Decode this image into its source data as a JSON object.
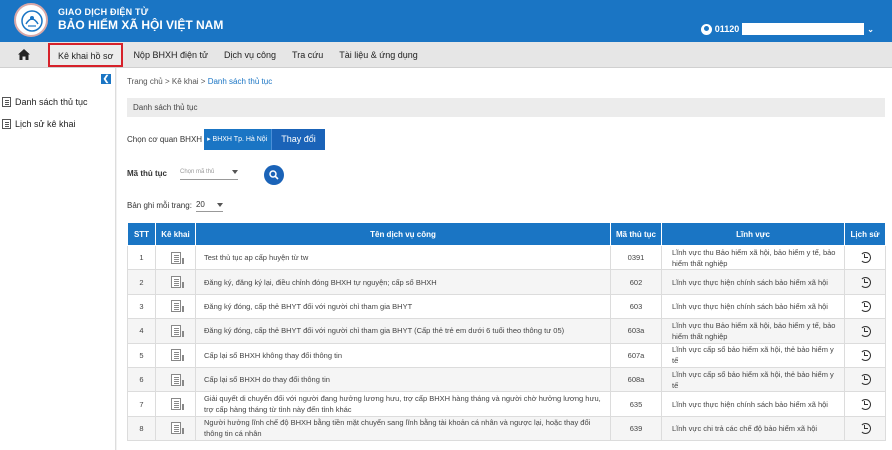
{
  "header": {
    "line1": "GIAO DỊCH ĐIỆN TỬ",
    "line2": "BẢO HIỂM XÃ HỘI VIỆT NAM",
    "user_prefix": "01120",
    "caret": "❯"
  },
  "menu": {
    "items": [
      {
        "label": "Kê khai hồ sơ"
      },
      {
        "label": "Nộp BHXH điện tử"
      },
      {
        "label": "Dịch vụ công"
      },
      {
        "label": "Tra cứu"
      },
      {
        "label": "Tài liệu & ứng dụng"
      }
    ]
  },
  "sidebar": {
    "items": [
      {
        "label": "Danh sách thủ tục"
      },
      {
        "label": "Lịch sử kê khai"
      }
    ]
  },
  "breadcrumb": {
    "home": "Trang chủ",
    "sep": ">",
    "level2": "Kê khai",
    "current": "Danh sách thủ tục"
  },
  "section_title": "Danh sách thủ tục",
  "agency": {
    "label": "Chọn cơ quan BHXH",
    "value": "BHXH Tp. Hà Nội",
    "change_label": "Thay đổi"
  },
  "filter": {
    "code_label": "Mã thủ tục",
    "code_placeholder": "Chọn mã thủ",
    "per_page_label": "Bản ghi mỗi trang:",
    "per_page_value": "20"
  },
  "table": {
    "headers": [
      "STT",
      "Kê khai",
      "Tên dịch vụ công",
      "Mã thủ tục",
      "Lĩnh vực",
      "Lịch sử"
    ],
    "rows": [
      {
        "stt": "1",
        "name": "Test thủ tục ap cấp huyện từ tw",
        "code": "0391",
        "field": "Lĩnh vực thu Bảo hiểm xã hội, bảo hiểm y tế, bảo hiểm thất nghiệp"
      },
      {
        "stt": "2",
        "name": "Đăng ký, đăng ký lại, điều chỉnh đóng BHXH tự nguyện; cấp sổ BHXH",
        "code": "602",
        "field": "Lĩnh vực thực hiện chính sách bảo hiểm xã hội"
      },
      {
        "stt": "3",
        "name": "Đăng ký đóng, cấp thẻ BHYT đối với người chỉ tham gia BHYT",
        "code": "603",
        "field": "Lĩnh vực thực hiện chính sách bảo hiểm xã hội"
      },
      {
        "stt": "4",
        "name": "Đăng ký đóng, cấp thẻ BHYT đối với người chỉ tham gia BHYT (Cấp thẻ trẻ em dưới 6 tuổi theo thông tư 05)",
        "code": "603a",
        "field": "Lĩnh vực thu Bảo hiểm xã hội, bảo hiểm y tế, bảo hiểm thất nghiệp"
      },
      {
        "stt": "5",
        "name": "Cấp lại sổ BHXH không thay đổi thông tin",
        "code": "607a",
        "field": "Lĩnh vực cấp sổ bảo hiểm xã hội, thẻ bảo hiểm y tế"
      },
      {
        "stt": "6",
        "name": "Cấp lại sổ BHXH do thay đổi thông tin",
        "code": "608a",
        "field": "Lĩnh vực cấp sổ bảo hiểm xã hội, thẻ bảo hiểm y tế"
      },
      {
        "stt": "7",
        "name": "Giải quyết di chuyển đối với người đang hưởng lương hưu, trợ cấp BHXH hàng tháng và người chờ hưởng lương hưu, trợ cấp hàng tháng từ tỉnh này đến tỉnh khác",
        "code": "635",
        "field": "Lĩnh vực thực hiện chính sách bảo hiểm xã hội"
      },
      {
        "stt": "8",
        "name": "Người hưởng lĩnh chế độ BHXH bằng tiền mặt chuyển sang lĩnh bằng tài khoản cá nhân và ngược lại, hoặc thay đổi thông tin cá nhân",
        "code": "639",
        "field": "Lĩnh vực chi trả các chế độ bảo hiểm xã hội"
      }
    ]
  }
}
